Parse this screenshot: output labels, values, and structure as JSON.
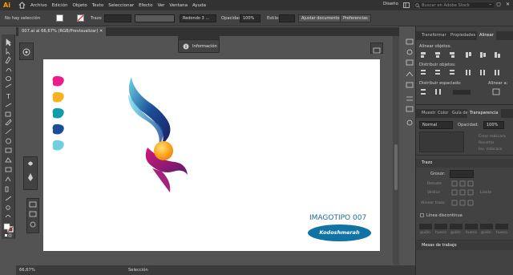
{
  "app": {
    "logo": "Ai",
    "menu": [
      "Archivo",
      "Edición",
      "Objeto",
      "Texto",
      "Seleccionar",
      "Efecto",
      "Ver",
      "Ventana",
      "Ayuda"
    ],
    "workspace": "Diseño",
    "search_placeholder": "Buscar en Adobe Stock"
  },
  "control_bar": {
    "selection_label": "No hay selección",
    "stroke_label": "Trazo",
    "brush_label": "Redondo 3 ...",
    "opacity_label": "Opacidad:",
    "opacity_value": "100%",
    "style_label": "Estilo:",
    "adjust_doc_button": "Ajustar documento",
    "preferences_button": "Preferencias"
  },
  "document": {
    "tab_title": "007.ai al 66,67% (RGB/Previsualizar)"
  },
  "info_panel": {
    "title": "Información"
  },
  "artboard": {
    "title": "IMAGOTIPO  007",
    "badge": "Kodoshmerah",
    "swatches": [
      "#ea1d8b",
      "#f7b21e",
      "#119bab",
      "#1a4f97",
      "#6fcfe0"
    ]
  },
  "status_bar": {
    "zoom": "66,67%",
    "tool": "Selección"
  },
  "right_dock": {
    "top_tabs": [
      "Transformar",
      "Propiedades",
      "Alinear"
    ],
    "align_objects_label": "Alinear objetos:",
    "distribute_objects_label": "Distribuir objetos:",
    "distribute_spacing_label": "Distribuir espaciado:",
    "align_to_label": "Alinear a:",
    "mid_tabs": [
      "Muestr",
      "Color",
      "Guía de",
      "Transparencia"
    ],
    "blend_mode": "Normal",
    "opacity_label": "Opacidad:",
    "opacity_value": "100%",
    "mask_button": "Crear máscara",
    "clip_label": "Recortar",
    "invert_label": "Inv. máscara",
    "stroke_panel_title": "Trazo",
    "weight_label": "Grosor:",
    "cap_label": "Remate",
    "corner_label": "Vértice",
    "limit_label": "Límite",
    "align_stroke_label": "Alinear trazo:",
    "dashed_label": "Línea discontinua",
    "dash_labels": [
      "guión",
      "hueco",
      "guión",
      "hueco",
      "guión",
      "hueco"
    ],
    "artboards_title": "Mesas de trabajo"
  }
}
